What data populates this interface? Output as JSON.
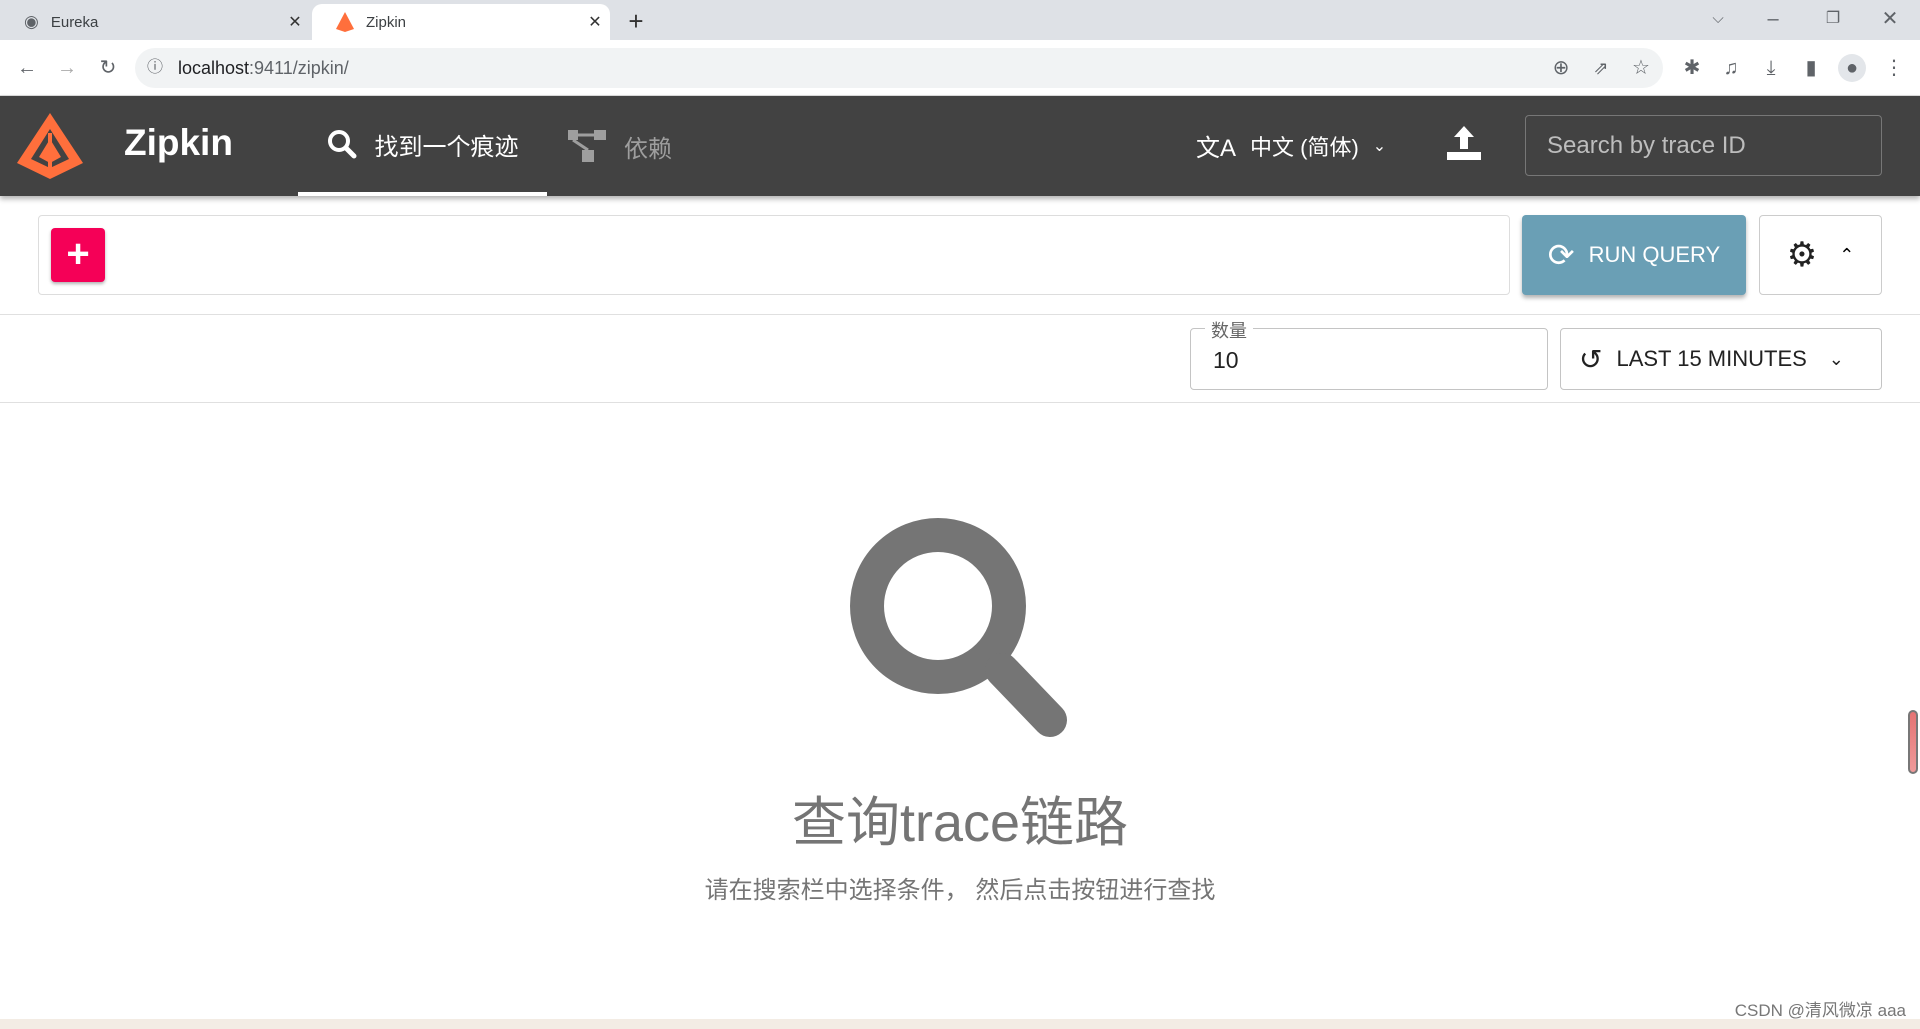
{
  "browser": {
    "tabs": [
      {
        "title": "Eureka",
        "icon": "globe-icon"
      },
      {
        "title": "Zipkin",
        "icon": "zipkin-logo-icon",
        "active": true
      }
    ],
    "url_host": "localhost",
    "url_rest": ":9411/zipkin/"
  },
  "header": {
    "brand": "Zipkin",
    "tabs": [
      {
        "label": "找到一个痕迹",
        "icon": "search-icon",
        "active": true
      },
      {
        "label": "依赖",
        "icon": "dependency-icon"
      }
    ],
    "language": "中文 (简体)",
    "search_placeholder": "Search by trace ID"
  },
  "query": {
    "run_label": "RUN QUERY",
    "limit_label": "数量",
    "limit_value": "10",
    "time_range": "LAST 15 MINUTES"
  },
  "empty": {
    "title": "查询trace链路",
    "subtitle": "请在搜索栏中选择条件， 然后点击按钮进行查找"
  },
  "watermark": "CSDN @清风微凉 aaa",
  "colors": {
    "header": "#424242",
    "accent": "#f50057",
    "run": "#6a9fb5",
    "logo": "#ff6f3c"
  }
}
